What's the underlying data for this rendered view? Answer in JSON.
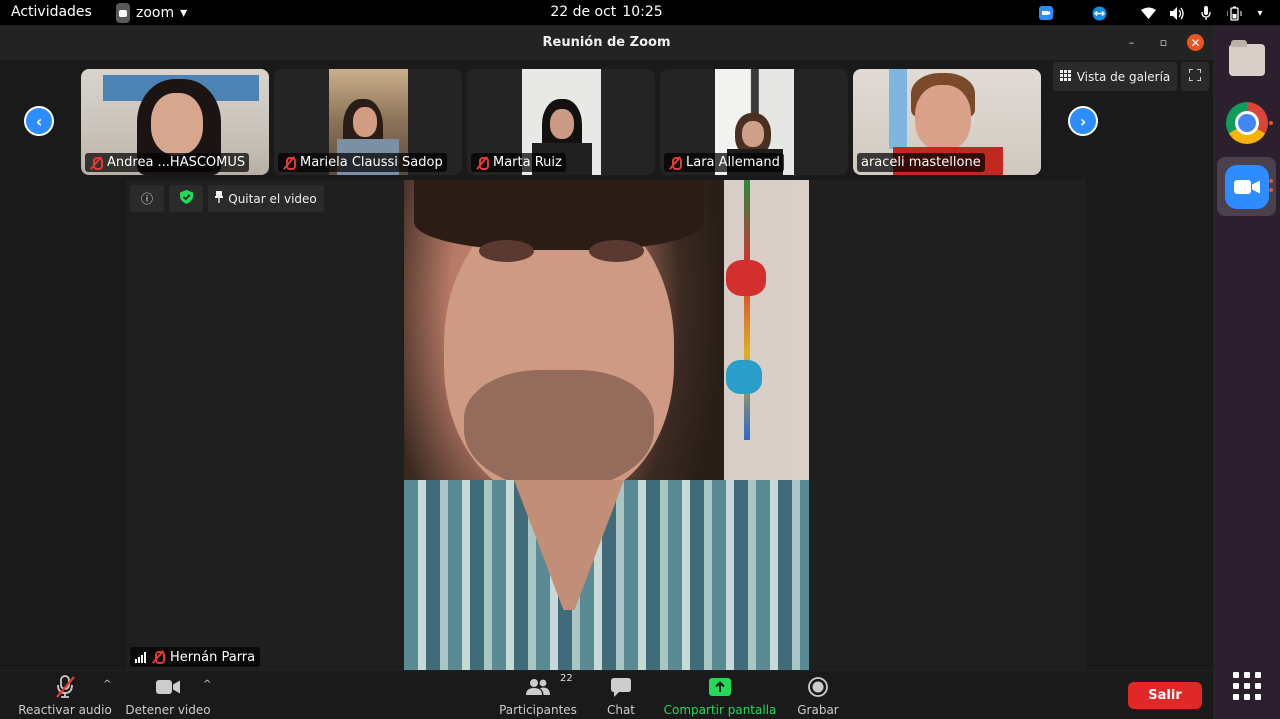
{
  "topbar": {
    "activities": "Actividades",
    "app_name": "zoom",
    "app_caret": "▾",
    "date": "22 de oct",
    "time": "10:25"
  },
  "window": {
    "title": "Reunión de Zoom",
    "minimize": "–",
    "restore": "▫",
    "close": "✕"
  },
  "gallery": {
    "prev": "‹",
    "next": "›",
    "view_label": "Vista de galería",
    "participants": [
      {
        "name": "Andrea ...HASCOMUS"
      },
      {
        "name": "Mariela Claussi Sadop"
      },
      {
        "name": "Marta Ruiz"
      },
      {
        "name": "Lara Allemand"
      },
      {
        "name": "araceli mastellone"
      }
    ]
  },
  "main": {
    "info_icon": "ⓘ",
    "unpin_label": "Quitar el video",
    "speaker_name": "Hernán Parra"
  },
  "toolbar": {
    "audio_label": "Reactivar audio",
    "video_label": "Detener video",
    "participants_label": "Participantes",
    "participants_count": "22",
    "chat_label": "Chat",
    "share_label": "Compartir pantalla",
    "record_label": "Grabar",
    "leave_label": "Salir",
    "caret": "^"
  },
  "colors": {
    "zoom_blue": "#2d8cff",
    "share_green": "#23d959",
    "leave_red": "#e02828",
    "muted_red": "#e53935",
    "ubuntu_orange": "#e95420"
  }
}
